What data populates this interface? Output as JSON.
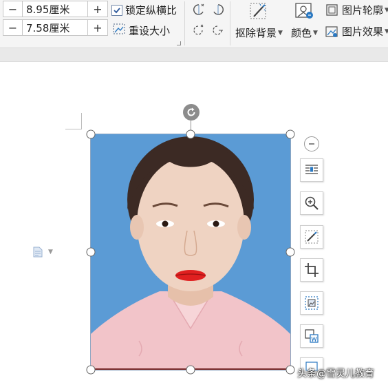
{
  "ribbon": {
    "width_field": {
      "minus": "−",
      "value": "8.95厘米",
      "plus": "+"
    },
    "height_field": {
      "minus": "−",
      "value": "7.58厘米",
      "plus": "+"
    },
    "lock_ratio_label": "锁定纵横比",
    "lock_ratio_checked": true,
    "reset_size_label": "重设大小",
    "remove_bg_label": "抠除背景",
    "color_label": "颜色",
    "outline_label": "图片轮廓",
    "effects_label": "图片效果"
  },
  "watermark": "头条@雪灵儿教育",
  "colors": {
    "photo_background": "#5b9bd5",
    "ribbon_bg": "#f5f5f5",
    "shirt": "#f2c4c9",
    "lips": "#e02020"
  },
  "float_toolbar_icons": [
    "collapse-icon",
    "layout-options-icon",
    "zoom-icon",
    "remove-bg-icon",
    "crop-icon",
    "picture-frame-icon",
    "convert-to-word-icon",
    "more-icon"
  ]
}
